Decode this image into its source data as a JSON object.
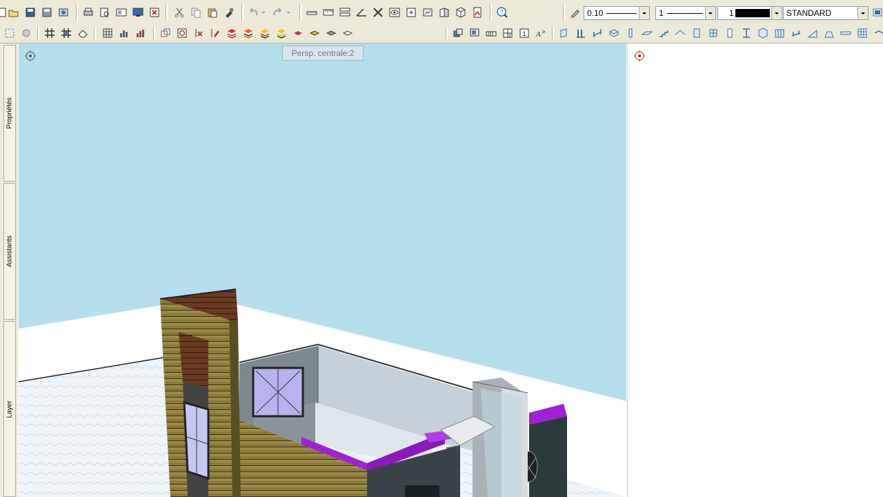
{
  "toolbar": {
    "pen_width": "0.10",
    "line_type": "1",
    "color_index": "1",
    "layer_style": "STANDARD",
    "colors": {
      "face": "#ece9d8",
      "accent_red": "#c0392b",
      "accent_blue": "#2f6fb5",
      "accent_yellow": "#e8c21e"
    }
  },
  "sidebar": {
    "tabs": [
      {
        "label": "Propriétés"
      },
      {
        "label": "Assistants"
      },
      {
        "label": "Layer"
      }
    ]
  },
  "viewport": {
    "view_label": "Persp. centrale:2",
    "sky_color": "#b5dfee",
    "ground_color": "#ffffff",
    "trim_color": "#a020d8"
  }
}
